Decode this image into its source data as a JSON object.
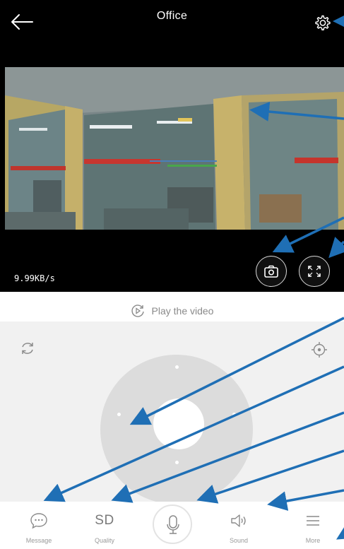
{
  "header": {
    "title": "Office",
    "back_icon": "arrow-left-icon",
    "settings_icon": "gear-icon"
  },
  "feed": {
    "speed": "9.99KB/s",
    "snapshot_icon": "camera-icon",
    "fullscreen_icon": "expand-icon"
  },
  "playback": {
    "label": "Play the video",
    "icon": "play-circle-icon"
  },
  "ptz": {
    "rotate_icon": "rotate-icon",
    "locate_icon": "crosshair-icon"
  },
  "toolbar": {
    "items": [
      {
        "label": "Message",
        "icon": "chat-bubble-icon"
      },
      {
        "label": "Quality",
        "text": "SD"
      },
      {
        "label": "",
        "icon": "microphone-icon"
      },
      {
        "label": "Sound",
        "icon": "speaker-icon"
      },
      {
        "label": "More",
        "icon": "menu-icon"
      }
    ]
  },
  "colors": {
    "background_dark": "#000000",
    "panel": "#f1f1f1",
    "arrow": "#1f6fb5"
  }
}
